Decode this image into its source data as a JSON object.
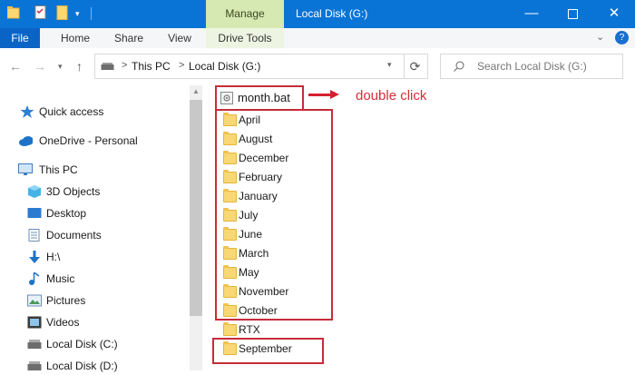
{
  "window": {
    "title": "Local Disk (G:)",
    "context_tab": "Manage",
    "controls": [
      "minimize-icon",
      "maximize-icon",
      "close-icon"
    ]
  },
  "ribbon": {
    "tabs": [
      "File",
      "Home",
      "Share",
      "View",
      "Drive Tools"
    ]
  },
  "address": {
    "crumbs": [
      "This PC",
      "Local Disk (G:)"
    ],
    "separator": ">",
    "search_placeholder": "Search Local Disk (G:)"
  },
  "nav_pane": {
    "items": [
      {
        "label": "Quick access",
        "icon": "star-icon"
      },
      {
        "label": "OneDrive - Personal",
        "icon": "cloud-icon"
      },
      {
        "label": "This PC",
        "icon": "monitor-icon"
      },
      {
        "label": "3D Objects",
        "icon": "cube-icon"
      },
      {
        "label": "Desktop",
        "icon": "desktop-icon"
      },
      {
        "label": "Documents",
        "icon": "document-icon"
      },
      {
        "label": "H:\\",
        "icon": "download-icon"
      },
      {
        "label": "Music",
        "icon": "music-icon"
      },
      {
        "label": "Pictures",
        "icon": "picture-icon"
      },
      {
        "label": "Videos",
        "icon": "video-icon"
      },
      {
        "label": "Local Disk (C:)",
        "icon": "drive-icon"
      },
      {
        "label": "Local Disk (D:)",
        "icon": "drive-icon"
      }
    ]
  },
  "files": {
    "batch_file": "month.bat",
    "folders": [
      "April",
      "August",
      "December",
      "February",
      "January",
      "July",
      "June",
      "March",
      "May",
      "November",
      "October",
      "RTX",
      "September"
    ]
  },
  "annotation": {
    "text": "double click",
    "color": "#d62c3a"
  },
  "colors": {
    "titlebar": "#0a74d6",
    "manage_tab": "#d6e9b3",
    "highlight_box": "#c62c3a",
    "folder": "#f8d775"
  }
}
